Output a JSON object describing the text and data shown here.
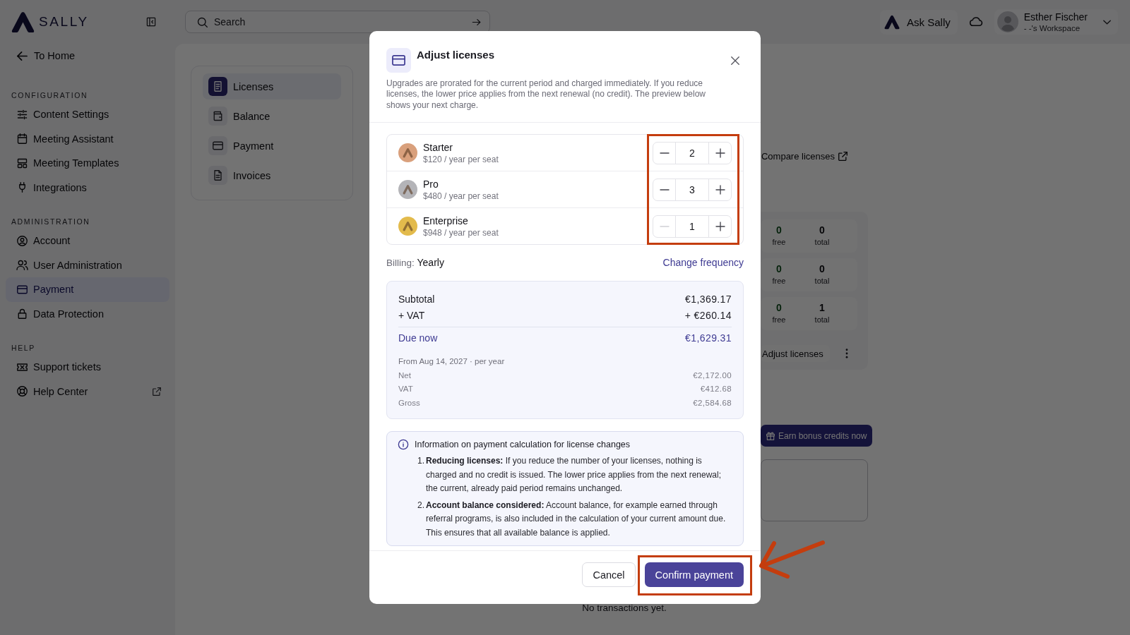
{
  "topbar": {
    "logo": "SALLY",
    "search": {
      "placeholder": "Search"
    },
    "ask_button": "Ask Sally",
    "user": {
      "name": "Esther Fischer",
      "workspace": "- -'s Workspace"
    }
  },
  "sidebar": {
    "back_link": "To Home",
    "sections": [
      {
        "title": "CONFIGURATION",
        "items": [
          {
            "label": "Content Settings",
            "selected": false,
            "external": false
          },
          {
            "label": "Meeting Assistant",
            "selected": false,
            "external": false
          },
          {
            "label": "Meeting Templates",
            "selected": false,
            "external": false
          },
          {
            "label": "Integrations",
            "selected": false,
            "external": false
          }
        ]
      },
      {
        "title": "ADMINISTRATION",
        "items": [
          {
            "label": "Account",
            "selected": false,
            "external": false
          },
          {
            "label": "User Administration",
            "selected": false,
            "external": false
          },
          {
            "label": "Payment",
            "selected": true,
            "external": false
          },
          {
            "label": "Data Protection",
            "selected": false,
            "external": false
          }
        ]
      },
      {
        "title": "HELP",
        "items": [
          {
            "label": "Support tickets",
            "selected": false,
            "external": false
          },
          {
            "label": "Help Center",
            "selected": false,
            "external": true
          }
        ]
      }
    ]
  },
  "subnav": {
    "items": [
      {
        "label": "Licenses",
        "selected": true
      },
      {
        "label": "Balance",
        "selected": false
      },
      {
        "label": "Payment",
        "selected": false
      },
      {
        "label": "Invoices",
        "selected": false
      }
    ]
  },
  "licenses_page": {
    "compare_link": "Compare licenses",
    "stats": [
      {
        "free": "0",
        "free_label": "free",
        "total": "0",
        "total_label": "total"
      },
      {
        "free": "0",
        "free_label": "free",
        "total": "0",
        "total_label": "total"
      },
      {
        "free": "0",
        "free_label": "free",
        "total": "1",
        "total_label": "total"
      }
    ],
    "adjust_button": "Adjust licenses",
    "bonus_button": "Earn bonus credits now",
    "empty_text": "No transactions yet."
  },
  "modal": {
    "title": "Adjust licenses",
    "description": "Upgrades are prorated for the current period and charged immediately. If you reduce licenses, the lower price applies from the next renewal (no credit). The preview below shows your next charge.",
    "licenses": [
      {
        "name": "Starter",
        "price": "$120 / year per seat",
        "color": "#d9a07c",
        "quantity": "2",
        "decrease_disabled": false
      },
      {
        "name": "Pro",
        "price": "$480 / year per seat",
        "color": "#b4b4b8",
        "quantity": "3",
        "decrease_disabled": false
      },
      {
        "name": "Enterprise",
        "price": "$948 / year per seat",
        "color": "#e3bb4c",
        "quantity": "1",
        "decrease_disabled": true
      }
    ],
    "billing": {
      "text": "Billing: **Yearly**",
      "link": "Change frequency"
    },
    "summary": {
      "rows": [
        {
          "label": "Subtotal",
          "value": "€1,369.17"
        },
        {
          "label": "+ VAT",
          "value": "+ €260.14"
        }
      ],
      "due": {
        "label": "Due now",
        "value": "€1,629.31"
      },
      "renewal": {
        "heading": "From Aug 14, 2027 · per year",
        "rows": [
          {
            "label": "Net",
            "value": "€2,172.00"
          },
          {
            "label": "VAT",
            "value": "€412.68"
          },
          {
            "label": "Gross",
            "value": "€2,584.68"
          }
        ]
      }
    },
    "info": {
      "title": "Information on payment calculation for license changes",
      "items": [
        {
          "number": "1.",
          "text": "**Reducing licenses:** If you reduce the number of your licenses, nothing is charged and no credit is issued. The lower price applies from the next renewal; the current, already paid period remains unchanged."
        },
        {
          "number": "2.",
          "text": "**Account balance considered:** Account balance, for example earned through referral programs, is also included in the calculation of your current amount due. This ensures that all available balance is applied."
        }
      ]
    },
    "buttons": {
      "cancel": "Cancel",
      "confirm": "Confirm payment"
    }
  }
}
